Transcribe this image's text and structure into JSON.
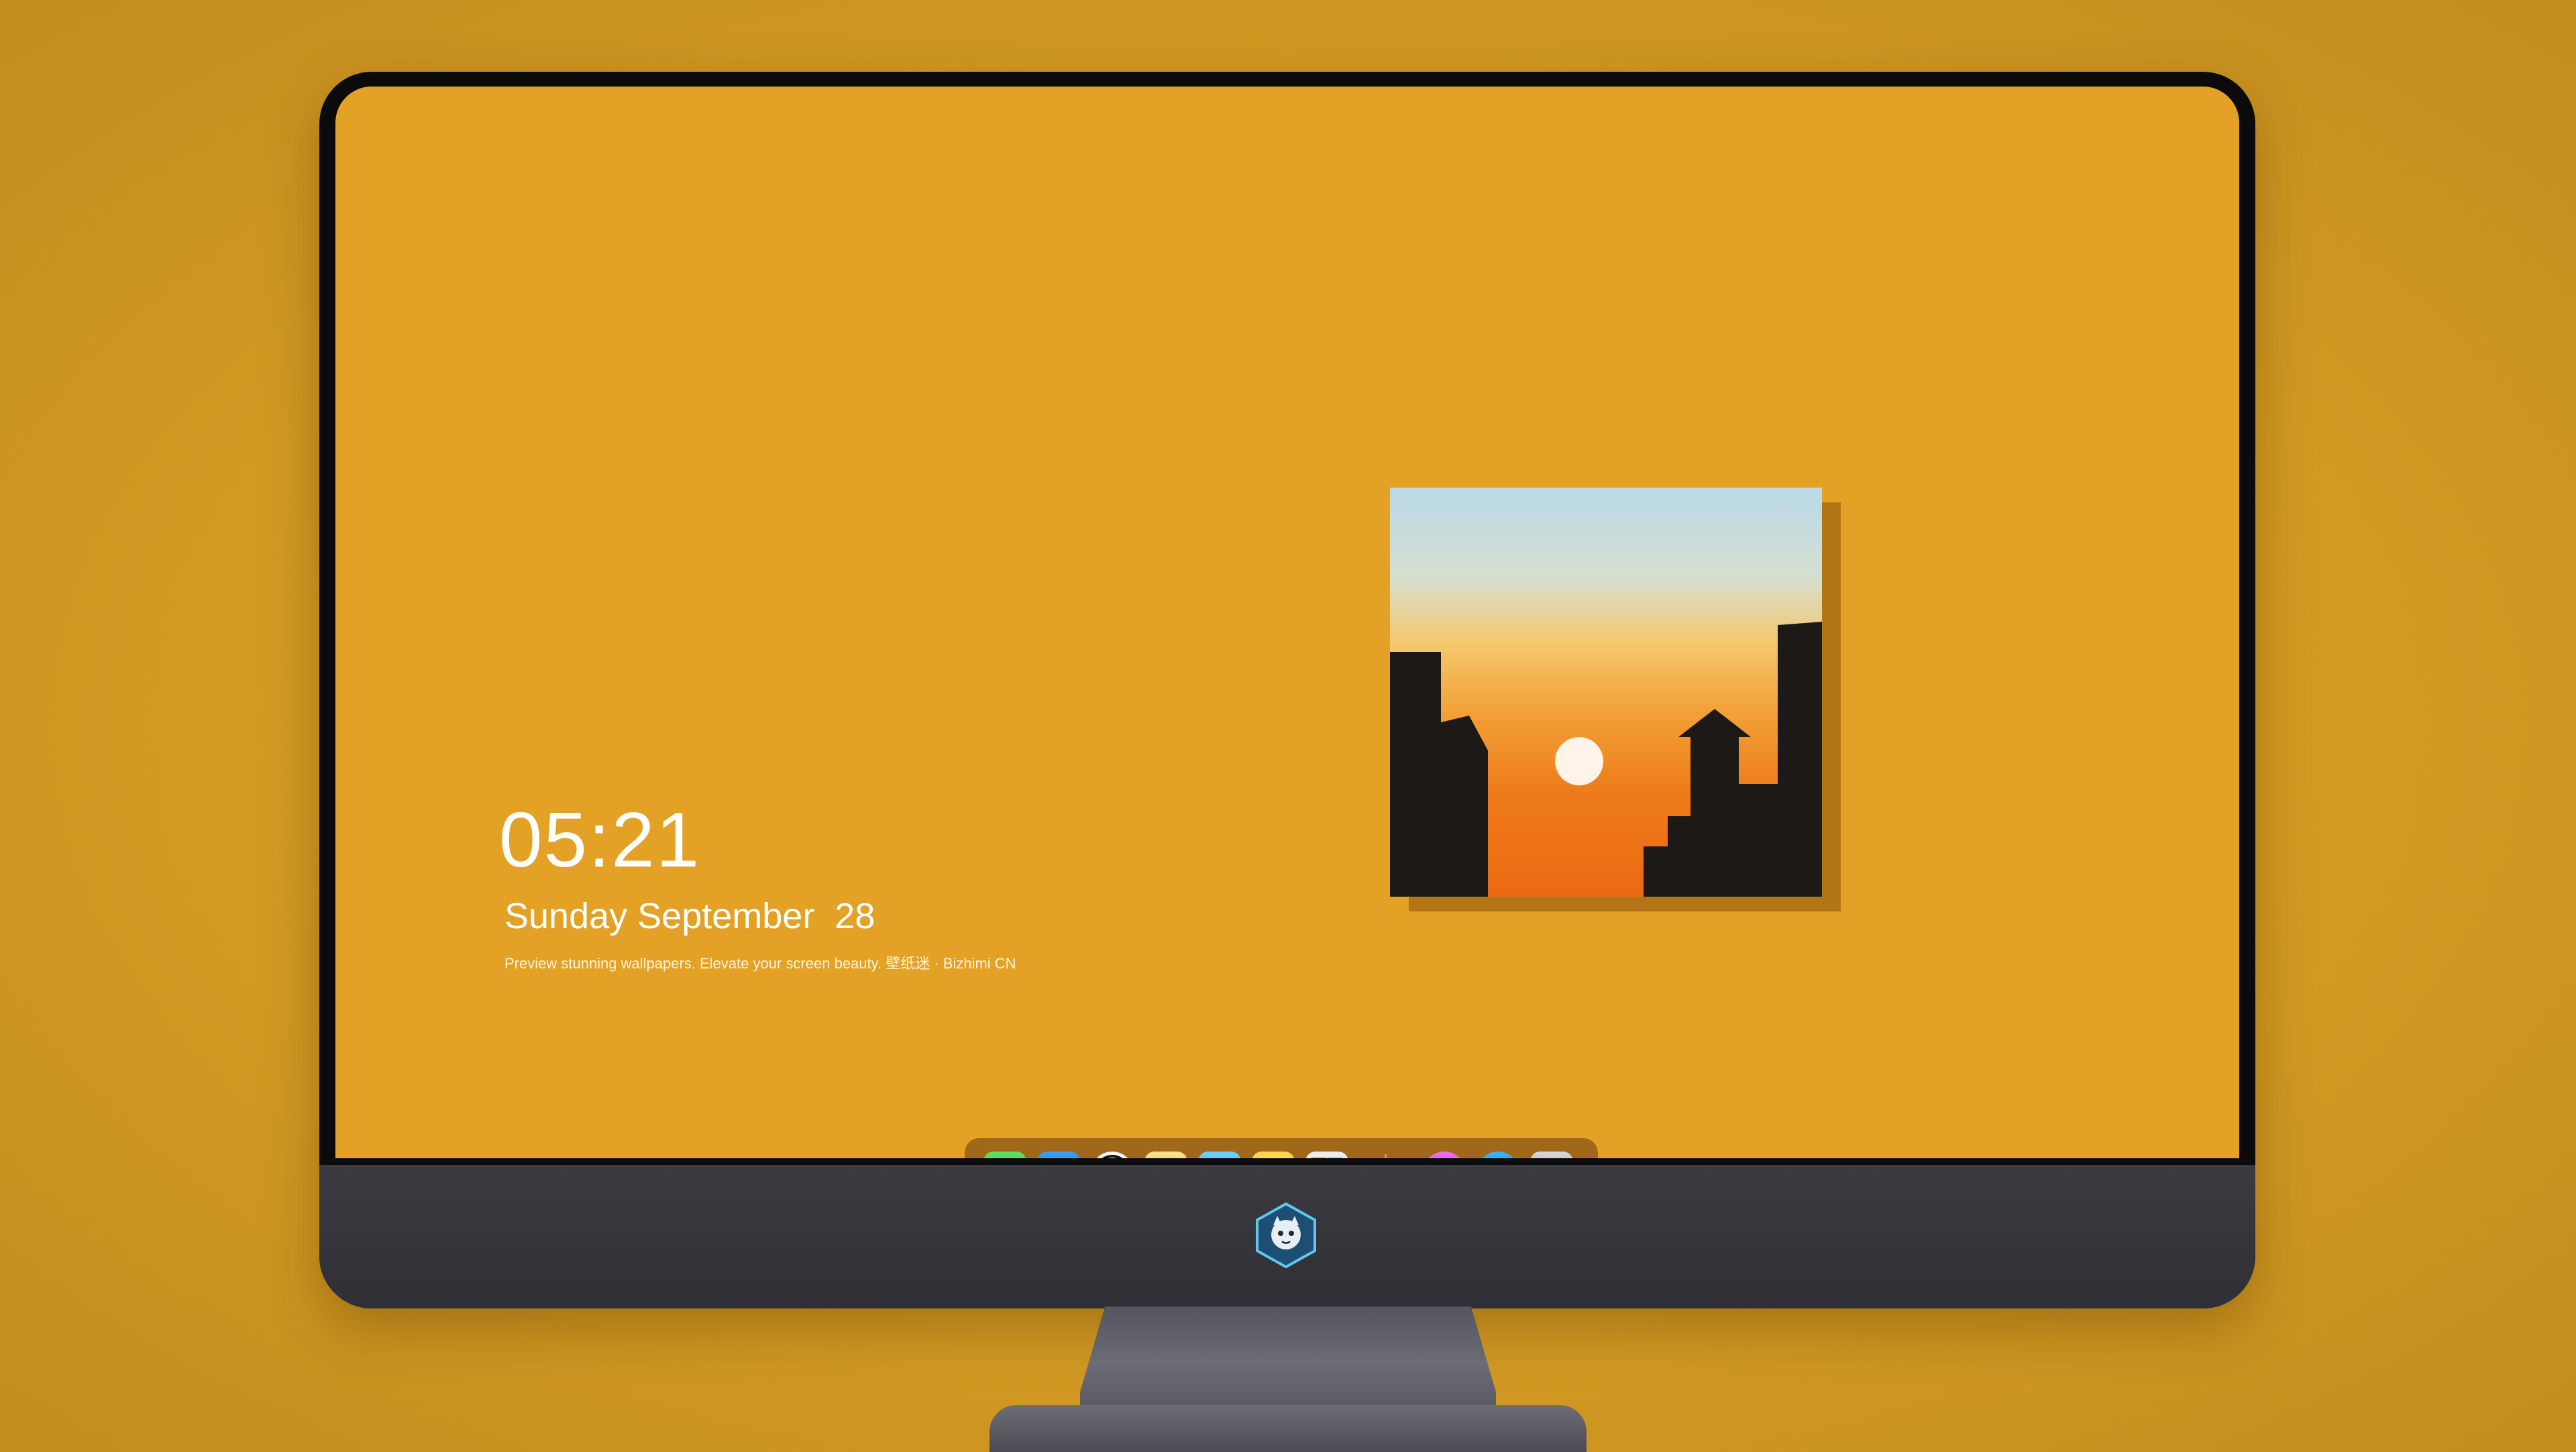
{
  "lockscreen": {
    "time": "05:21",
    "date": "Sunday September  28",
    "caption": "Preview stunning wallpapers. Elevate your screen beauty. 壁纸迷 · Bizhimi CN"
  },
  "colors": {
    "background": "#d29a22",
    "screen": "#e3a126",
    "bezel": "#0b0b0b",
    "chin": "#333338"
  },
  "dock": {
    "apps": [
      {
        "name": "messages-icon"
      },
      {
        "name": "weather-icon"
      },
      {
        "name": "clock-icon"
      },
      {
        "name": "preview-icon"
      },
      {
        "name": "clips-icon"
      },
      {
        "name": "notes-icon"
      },
      {
        "name": "photo-booth-icon"
      }
    ],
    "apps_right": [
      {
        "name": "itunes-icon"
      },
      {
        "name": "app-store-icon"
      },
      {
        "name": "camera-icon"
      }
    ]
  },
  "artwork": {
    "subject": "sunset-city-painting-icon"
  },
  "chin_logo": {
    "icon": "mascot-logo-icon"
  }
}
